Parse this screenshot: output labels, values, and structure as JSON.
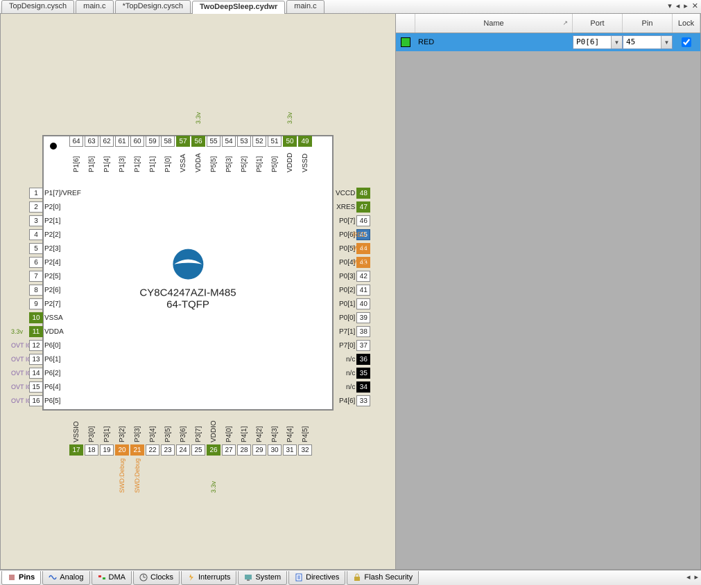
{
  "tabs": {
    "topdesign1": "TopDesign.cysch",
    "mainc1": "main.c",
    "topdesign2": "*TopDesign.cysch",
    "active": "TwoDeepSleep.cydwr",
    "mainc2": "main.c"
  },
  "chip": {
    "part": "CY8C4247AZI-M485",
    "package": "64-TQFP"
  },
  "pins_left": [
    {
      "n": "1",
      "lbl": "P1[7]/VREF",
      "c": "",
      "ext": ""
    },
    {
      "n": "2",
      "lbl": "P2[0]",
      "c": "",
      "ext": ""
    },
    {
      "n": "3",
      "lbl": "P2[1]",
      "c": "",
      "ext": ""
    },
    {
      "n": "4",
      "lbl": "P2[2]",
      "c": "",
      "ext": ""
    },
    {
      "n": "5",
      "lbl": "P2[3]",
      "c": "",
      "ext": ""
    },
    {
      "n": "6",
      "lbl": "P2[4]",
      "c": "",
      "ext": ""
    },
    {
      "n": "7",
      "lbl": "P2[5]",
      "c": "",
      "ext": ""
    },
    {
      "n": "8",
      "lbl": "P2[6]",
      "c": "",
      "ext": ""
    },
    {
      "n": "9",
      "lbl": "P2[7]",
      "c": "",
      "ext": ""
    },
    {
      "n": "10",
      "lbl": "VSSA",
      "c": "green",
      "ext": ""
    },
    {
      "n": "11",
      "lbl": "VDDA",
      "c": "green",
      "ext": "3.3v",
      "ec": "green"
    },
    {
      "n": "12",
      "lbl": "P6[0]",
      "c": "",
      "ext": "OVT IO",
      "ec": "purple"
    },
    {
      "n": "13",
      "lbl": "P6[1]",
      "c": "",
      "ext": "OVT IO",
      "ec": "purple"
    },
    {
      "n": "14",
      "lbl": "P6[2]",
      "c": "",
      "ext": "OVT IO",
      "ec": "purple"
    },
    {
      "n": "15",
      "lbl": "P6[4]",
      "c": "",
      "ext": "OVT IO",
      "ec": "purple"
    },
    {
      "n": "16",
      "lbl": "P6[5]",
      "c": "",
      "ext": "OVT IO",
      "ec": "purple"
    }
  ],
  "pins_right": [
    {
      "n": "48",
      "lbl": "VCCD",
      "c": "green",
      "ext": ""
    },
    {
      "n": "47",
      "lbl": "XRES",
      "c": "green",
      "ext": ""
    },
    {
      "n": "46",
      "lbl": "P0[7]",
      "c": "",
      "ext": ""
    },
    {
      "n": "45",
      "lbl": "P0[6]",
      "c": "blue",
      "ext": "RED",
      "ec": "orange"
    },
    {
      "n": "44",
      "lbl": "P0[5]",
      "c": "orange",
      "ext": "WCO",
      "ec": "orange"
    },
    {
      "n": "43",
      "lbl": "P0[4]",
      "c": "orange",
      "ext": "WCO",
      "ec": "orange"
    },
    {
      "n": "42",
      "lbl": "P0[3]",
      "c": "",
      "ext": ""
    },
    {
      "n": "41",
      "lbl": "P0[2]",
      "c": "",
      "ext": ""
    },
    {
      "n": "40",
      "lbl": "P0[1]",
      "c": "",
      "ext": ""
    },
    {
      "n": "39",
      "lbl": "P0[0]",
      "c": "",
      "ext": ""
    },
    {
      "n": "38",
      "lbl": "P7[1]",
      "c": "",
      "ext": ""
    },
    {
      "n": "37",
      "lbl": "P7[0]",
      "c": "",
      "ext": ""
    },
    {
      "n": "36",
      "lbl": "n/c",
      "c": "black",
      "ext": ""
    },
    {
      "n": "35",
      "lbl": "n/c",
      "c": "black",
      "ext": ""
    },
    {
      "n": "34",
      "lbl": "n/c",
      "c": "black",
      "ext": ""
    },
    {
      "n": "33",
      "lbl": "P4[6]",
      "c": "",
      "ext": ""
    }
  ],
  "pins_top": [
    {
      "n": "64",
      "lbl": "P1[6]",
      "c": "",
      "ext": ""
    },
    {
      "n": "63",
      "lbl": "P1[5]",
      "c": "",
      "ext": ""
    },
    {
      "n": "62",
      "lbl": "P1[4]",
      "c": "",
      "ext": ""
    },
    {
      "n": "61",
      "lbl": "P1[3]",
      "c": "",
      "ext": ""
    },
    {
      "n": "60",
      "lbl": "P1[2]",
      "c": "",
      "ext": ""
    },
    {
      "n": "59",
      "lbl": "P1[1]",
      "c": "",
      "ext": ""
    },
    {
      "n": "58",
      "lbl": "P1[0]",
      "c": "",
      "ext": ""
    },
    {
      "n": "57",
      "lbl": "VSSA",
      "c": "green",
      "ext": ""
    },
    {
      "n": "56",
      "lbl": "VDDA",
      "c": "green",
      "ext": "3.3v",
      "ec": "green"
    },
    {
      "n": "55",
      "lbl": "P5[5]",
      "c": "",
      "ext": ""
    },
    {
      "n": "54",
      "lbl": "P5[3]",
      "c": "",
      "ext": ""
    },
    {
      "n": "53",
      "lbl": "P5[2]",
      "c": "",
      "ext": ""
    },
    {
      "n": "52",
      "lbl": "P5[1]",
      "c": "",
      "ext": ""
    },
    {
      "n": "51",
      "lbl": "P5[0]",
      "c": "",
      "ext": ""
    },
    {
      "n": "50",
      "lbl": "VDDD",
      "c": "green",
      "ext": "3.3v",
      "ec": "green"
    },
    {
      "n": "49",
      "lbl": "VSSD",
      "c": "green",
      "ext": ""
    }
  ],
  "pins_bottom": [
    {
      "n": "17",
      "lbl": "VSSIO",
      "c": "green",
      "ext": ""
    },
    {
      "n": "18",
      "lbl": "P3[0]",
      "c": "",
      "ext": ""
    },
    {
      "n": "19",
      "lbl": "P3[1]",
      "c": "",
      "ext": ""
    },
    {
      "n": "20",
      "lbl": "P3[2]",
      "c": "orange",
      "ext": "SWD:Debug",
      "ec": "orange"
    },
    {
      "n": "21",
      "lbl": "P3[3]",
      "c": "orange",
      "ext": "SWD:Debug",
      "ec": "orange"
    },
    {
      "n": "22",
      "lbl": "P3[4]",
      "c": "",
      "ext": ""
    },
    {
      "n": "23",
      "lbl": "P3[5]",
      "c": "",
      "ext": ""
    },
    {
      "n": "24",
      "lbl": "P3[6]",
      "c": "",
      "ext": ""
    },
    {
      "n": "25",
      "lbl": "P3[7]",
      "c": "",
      "ext": ""
    },
    {
      "n": "26",
      "lbl": "VDDIO",
      "c": "green",
      "ext": "3.3v",
      "ec": "green"
    },
    {
      "n": "27",
      "lbl": "P4[0]",
      "c": "",
      "ext": ""
    },
    {
      "n": "28",
      "lbl": "P4[1]",
      "c": "",
      "ext": ""
    },
    {
      "n": "29",
      "lbl": "P4[2]",
      "c": "",
      "ext": ""
    },
    {
      "n": "30",
      "lbl": "P4[3]",
      "c": "",
      "ext": ""
    },
    {
      "n": "31",
      "lbl": "P4[4]",
      "c": "",
      "ext": ""
    },
    {
      "n": "32",
      "lbl": "P4[5]",
      "c": "",
      "ext": ""
    }
  ],
  "table": {
    "headers": {
      "name": "Name",
      "port": "Port",
      "pin": "Pin",
      "lock": "Lock"
    },
    "row": {
      "name": "RED",
      "port": "P0[6]",
      "pin": "45",
      "lock": true
    }
  },
  "bottomTabs": {
    "pins": "Pins",
    "analog": "Analog",
    "dma": "DMA",
    "clocks": "Clocks",
    "interrupts": "Interrupts",
    "system": "System",
    "directives": "Directives",
    "flash": "Flash Security"
  }
}
